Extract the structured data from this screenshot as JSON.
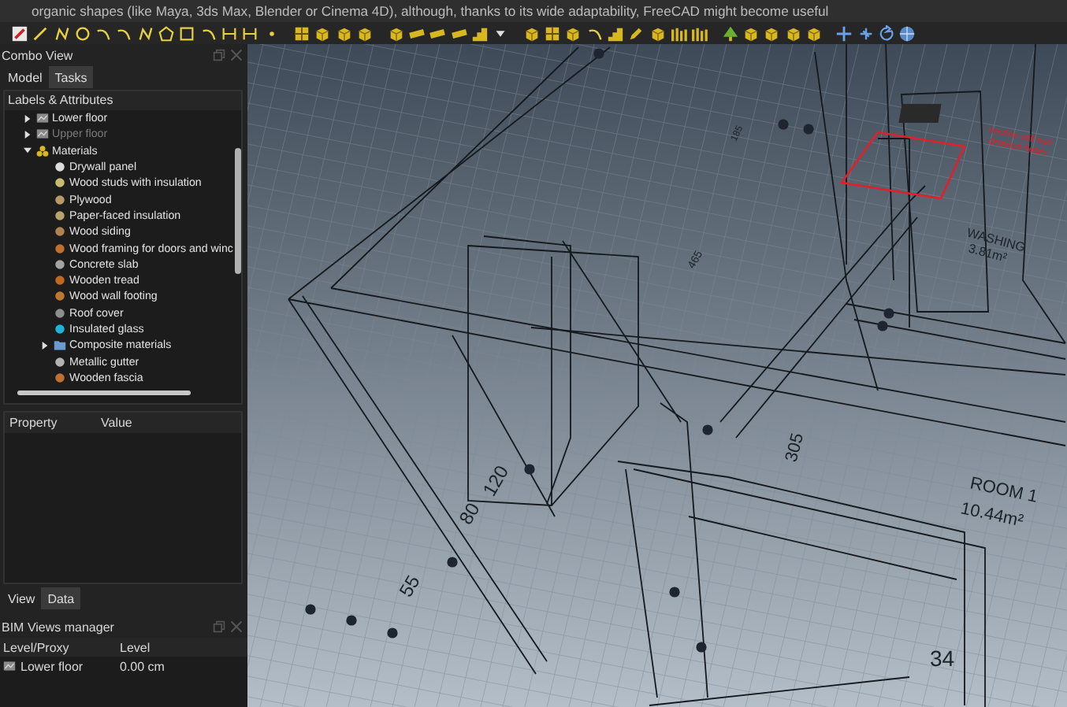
{
  "caption": "organic shapes (like Maya, 3ds Max, Blender or Cinema 4D), although, thanks to its wide adaptability, FreeCAD might become useful",
  "combo_view": {
    "title": "Combo View",
    "tabs": [
      {
        "label": "Model",
        "selected": true
      },
      {
        "label": "Tasks",
        "selected": false
      }
    ],
    "tree_header": "Labels & Attributes",
    "tree": [
      {
        "label": "Lower floor",
        "kind": "level",
        "expanded": false,
        "hidden": false
      },
      {
        "label": "Upper floor",
        "kind": "level",
        "expanded": false,
        "hidden": true
      },
      {
        "label": "Materials",
        "kind": "group",
        "expanded": true,
        "hidden": false,
        "children": [
          {
            "label": "Drywall panel",
            "kind": "material",
            "color": "#dcdcdc"
          },
          {
            "label": "Wood studs with insulation",
            "kind": "material",
            "color": "#c9bb72"
          },
          {
            "label": "Plywood",
            "kind": "material",
            "color": "#b89a68"
          },
          {
            "label": "Paper-faced insulation",
            "kind": "material",
            "color": "#b9a26e"
          },
          {
            "label": "Wood siding",
            "kind": "material",
            "color": "#b08352"
          },
          {
            "label": "Wood framing for doors and winc",
            "kind": "material",
            "color": "#c06f2e"
          },
          {
            "label": "Concrete slab",
            "kind": "material",
            "color": "#a5a5a5"
          },
          {
            "label": "Wooden tread",
            "kind": "material",
            "color": "#c0681f"
          },
          {
            "label": "Wood wall footing",
            "kind": "material",
            "color": "#c07830"
          },
          {
            "label": "Roof cover",
            "kind": "material",
            "color": "#8e8e8e"
          },
          {
            "label": "Insulated glass",
            "kind": "material",
            "color": "#1fb4d6"
          },
          {
            "label": "Composite materials",
            "kind": "folder",
            "expanded": false
          },
          {
            "label": "Metallic gutter",
            "kind": "material",
            "color": "#b2b2b2"
          },
          {
            "label": "Wooden fascia",
            "kind": "material",
            "color": "#c0702e"
          }
        ]
      }
    ]
  },
  "properties": {
    "columns": [
      "Property",
      "Value"
    ],
    "tabs": [
      {
        "label": "View",
        "selected": true
      },
      {
        "label": "Data",
        "selected": false
      }
    ]
  },
  "bim_views": {
    "title": "BIM Views manager",
    "columns": [
      "Level/Proxy",
      "Level"
    ],
    "rows": [
      {
        "name": "Lower floor",
        "level": "0.00 cm"
      }
    ]
  },
  "viewport": {
    "labels": [
      {
        "text": "55",
        "kind": "dimension"
      },
      {
        "text": "80",
        "kind": "dimension"
      },
      {
        "text": "120",
        "kind": "dimension"
      },
      {
        "text": "305",
        "kind": "dimension"
      },
      {
        "text": "465",
        "kind": "dimension"
      },
      {
        "text": "185",
        "kind": "dimension"
      },
      {
        "text": "34",
        "kind": "dimension"
      },
      {
        "text": "ROOM 1",
        "kind": "room"
      },
      {
        "text": "10.44m²",
        "kind": "area"
      },
      {
        "text": "WASHING",
        "kind": "room"
      },
      {
        "text": "3.81m²",
        "kind": "area"
      },
      {
        "text": "nection still nee",
        "kind": "note"
      },
      {
        "text": "detailed better",
        "kind": "note"
      }
    ]
  }
}
